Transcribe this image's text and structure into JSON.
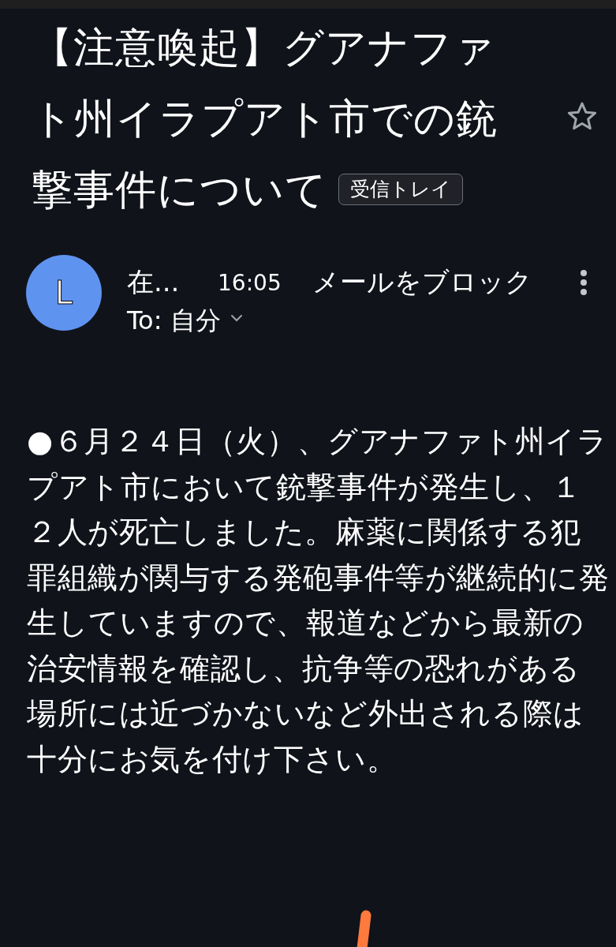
{
  "subject": {
    "title": "【注意喚起】グアナファト州イラプアト市での銃撃事件について",
    "label": "受信トレイ",
    "starred": false
  },
  "message": {
    "avatar_letter": "L",
    "sender": "在...",
    "time": "16:05",
    "block_link": "メールをブロック",
    "recipient": "To: 自分"
  },
  "body": "●６月２４日（火）、グアナファト州イラプアト市において銃撃事件が発生し、１２人が死亡しました。麻薬に関係する犯罪組織が関与する発砲事件等が継続的に発生していますので、報道などから最新の治安情報を確認し、抗争等の恐れがある場所には近づかないなど外出される際は十分にお気を付け下さい。"
}
